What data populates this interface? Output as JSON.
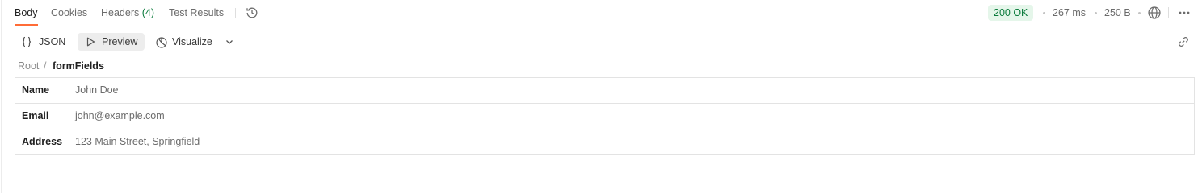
{
  "response": {
    "tabs": [
      {
        "label": "Body"
      },
      {
        "label": "Cookies"
      },
      {
        "label": "Headers",
        "count": "(4)"
      },
      {
        "label": "Test Results"
      }
    ],
    "status": "200 OK",
    "time": "267 ms",
    "size": "250 B",
    "icons": [
      "history-icon",
      "globe-icon",
      "more-options-icon"
    ]
  },
  "toolbar": {
    "json_label": "JSON",
    "preview_label": "Preview",
    "visualize_label": "Visualize",
    "icons": [
      "braces-icon",
      "play-icon",
      "visualize-icon",
      "chevron-down-icon",
      "link-icon"
    ]
  },
  "breadcrumb": {
    "root": "Root",
    "separator": "/",
    "current": "formFields"
  },
  "table": {
    "rows": [
      {
        "key": "Name",
        "value": "John Doe"
      },
      {
        "key": "Email",
        "value": "john@example.com"
      },
      {
        "key": "Address",
        "value": "123 Main Street, Springfield"
      }
    ]
  },
  "colors": {
    "accent": "#ff6c37",
    "success_text": "#0a7a3b",
    "success_bg": "#e5f6ea"
  }
}
